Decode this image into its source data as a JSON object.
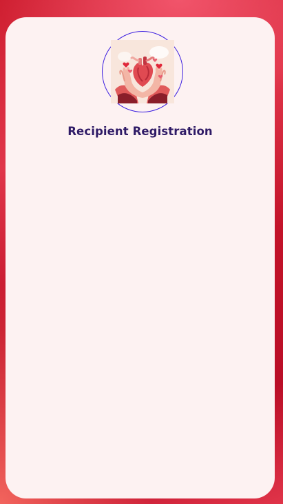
{
  "page": {
    "title": "Recipient Registration"
  },
  "illustration": {
    "icon": "heart-in-hands-icon",
    "accent_color": "#3b1ee0"
  },
  "colors": {
    "title": "#2e1a66",
    "card_background": "#fdf2f2",
    "backdrop": "#c21329"
  }
}
